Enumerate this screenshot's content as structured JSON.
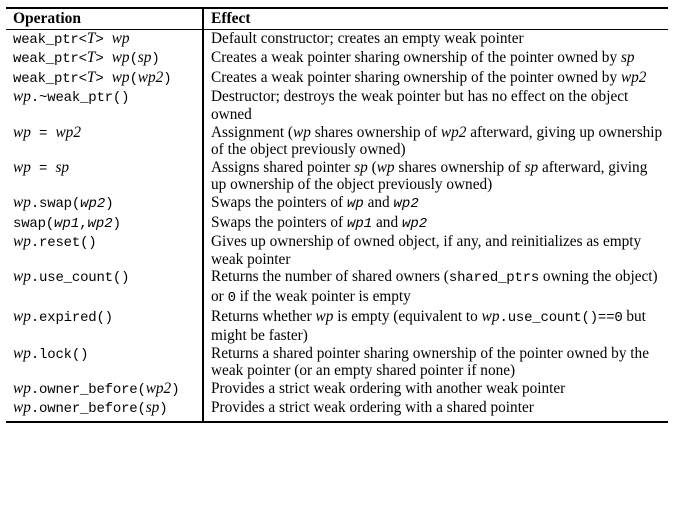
{
  "table": {
    "headers": {
      "operation": "Operation",
      "effect": "Effect"
    },
    "rows": [
      {
        "operation": [
          {
            "t": "weak_ptr<",
            "s": "mono"
          },
          {
            "t": "T",
            "s": "it"
          },
          {
            "t": "> ",
            "s": "mono"
          },
          {
            "t": "wp",
            "s": "it"
          }
        ],
        "effect": [
          {
            "t": "Default constructor; creates an empty weak pointer",
            "s": "rm"
          }
        ]
      },
      {
        "operation": [
          {
            "t": "weak_ptr<",
            "s": "mono"
          },
          {
            "t": "T",
            "s": "it"
          },
          {
            "t": "> ",
            "s": "mono"
          },
          {
            "t": "wp",
            "s": "it"
          },
          {
            "t": "(",
            "s": "mono"
          },
          {
            "t": "sp",
            "s": "it"
          },
          {
            "t": ")",
            "s": "mono"
          }
        ],
        "effect": [
          {
            "t": "Creates a weak pointer sharing ownership of the pointer owned by ",
            "s": "rm"
          },
          {
            "t": "sp",
            "s": "it"
          }
        ]
      },
      {
        "operation": [
          {
            "t": "weak_ptr<",
            "s": "mono"
          },
          {
            "t": "T",
            "s": "it"
          },
          {
            "t": "> ",
            "s": "mono"
          },
          {
            "t": "wp",
            "s": "it"
          },
          {
            "t": "(",
            "s": "mono"
          },
          {
            "t": "wp2",
            "s": "it"
          },
          {
            "t": ")",
            "s": "mono"
          }
        ],
        "effect": [
          {
            "t": "Creates a weak pointer sharing ownership of the pointer owned by ",
            "s": "rm"
          },
          {
            "t": "wp2",
            "s": "it"
          }
        ]
      },
      {
        "operation": [
          {
            "t": "wp",
            "s": "it"
          },
          {
            "t": ".~weak_ptr()",
            "s": "mono"
          }
        ],
        "effect": [
          {
            "t": "Destructor; destroys the weak pointer but has no effect on the object owned",
            "s": "rm"
          }
        ]
      },
      {
        "operation": [
          {
            "t": "wp",
            "s": "it"
          },
          {
            "t": " = ",
            "s": "mono"
          },
          {
            "t": "wp2",
            "s": "it"
          }
        ],
        "effect": [
          {
            "t": "Assignment (",
            "s": "rm"
          },
          {
            "t": "wp",
            "s": "it"
          },
          {
            "t": " shares ownership of ",
            "s": "rm"
          },
          {
            "t": "wp2",
            "s": "it"
          },
          {
            "t": " afterward, giving up ownership of the object previously owned)",
            "s": "rm"
          }
        ]
      },
      {
        "operation": [
          {
            "t": "wp",
            "s": "it"
          },
          {
            "t": " = ",
            "s": "mono"
          },
          {
            "t": "sp",
            "s": "it"
          }
        ],
        "effect": [
          {
            "t": "Assigns shared pointer ",
            "s": "rm"
          },
          {
            "t": "sp",
            "s": "it"
          },
          {
            "t": " (",
            "s": "rm"
          },
          {
            "t": "wp",
            "s": "it"
          },
          {
            "t": " shares ownership of ",
            "s": "rm"
          },
          {
            "t": "sp",
            "s": "it"
          },
          {
            "t": " afterward, giving up ownership of the object previously owned)",
            "s": "rm"
          }
        ]
      },
      {
        "operation": [
          {
            "t": "wp",
            "s": "it"
          },
          {
            "t": ".swap(",
            "s": "mono"
          },
          {
            "t": "wp2",
            "s": "itm"
          },
          {
            "t": ")",
            "s": "mono"
          }
        ],
        "effect": [
          {
            "t": "Swaps the pointers of ",
            "s": "rm"
          },
          {
            "t": "wp",
            "s": "itm"
          },
          {
            "t": " and ",
            "s": "rm"
          },
          {
            "t": "wp2",
            "s": "itm"
          }
        ]
      },
      {
        "operation": [
          {
            "t": "swap(",
            "s": "mono"
          },
          {
            "t": "wp1",
            "s": "itm"
          },
          {
            "t": ",",
            "s": "mono"
          },
          {
            "t": "wp2",
            "s": "itm"
          },
          {
            "t": ")",
            "s": "mono"
          }
        ],
        "effect": [
          {
            "t": "Swaps the pointers of ",
            "s": "rm"
          },
          {
            "t": "wp1",
            "s": "itm"
          },
          {
            "t": " and ",
            "s": "rm"
          },
          {
            "t": "wp2",
            "s": "itm"
          }
        ]
      },
      {
        "operation": [
          {
            "t": "wp",
            "s": "it"
          },
          {
            "t": ".reset()",
            "s": "mono"
          }
        ],
        "effect": [
          {
            "t": "Gives up ownership of owned object, if any, and reinitializes as empty weak pointer",
            "s": "rm"
          }
        ]
      },
      {
        "operation": [
          {
            "t": "wp",
            "s": "it"
          },
          {
            "t": ".use_count()",
            "s": "mono"
          }
        ],
        "effect": [
          {
            "t": "Returns the number of shared owners (",
            "s": "rm"
          },
          {
            "t": "shared_ptrs",
            "s": "mono"
          },
          {
            "t": " owning the object) or ",
            "s": "rm"
          },
          {
            "t": "0",
            "s": "mono"
          },
          {
            "t": " if the weak pointer is empty",
            "s": "rm"
          }
        ]
      },
      {
        "operation": [
          {
            "t": "wp",
            "s": "it"
          },
          {
            "t": ".expired()",
            "s": "mono"
          }
        ],
        "effect": [
          {
            "t": "Returns whether ",
            "s": "rm"
          },
          {
            "t": "wp",
            "s": "it"
          },
          {
            "t": " is empty (equivalent to ",
            "s": "rm"
          },
          {
            "t": "wp",
            "s": "it"
          },
          {
            "t": ".use_count()==0",
            "s": "mono"
          },
          {
            "t": " but might be faster)",
            "s": "rm"
          }
        ]
      },
      {
        "operation": [
          {
            "t": "wp",
            "s": "it"
          },
          {
            "t": ".lock()",
            "s": "mono"
          }
        ],
        "effect": [
          {
            "t": "Returns a shared pointer sharing ownership of the pointer owned by the weak pointer (or an empty shared pointer if none)",
            "s": "rm"
          }
        ]
      },
      {
        "operation": [
          {
            "t": "wp",
            "s": "it"
          },
          {
            "t": ".owner_before(",
            "s": "mono"
          },
          {
            "t": "wp2",
            "s": "it"
          },
          {
            "t": ")",
            "s": "mono"
          }
        ],
        "effect": [
          {
            "t": "Provides a strict weak ordering with another weak pointer",
            "s": "rm"
          }
        ]
      },
      {
        "operation": [
          {
            "t": "wp",
            "s": "it"
          },
          {
            "t": ".owner_before(",
            "s": "mono"
          },
          {
            "t": "sp",
            "s": "it"
          },
          {
            "t": ")",
            "s": "mono"
          }
        ],
        "effect": [
          {
            "t": "Provides a strict weak ordering with a shared pointer",
            "s": "rm"
          }
        ]
      }
    ]
  }
}
